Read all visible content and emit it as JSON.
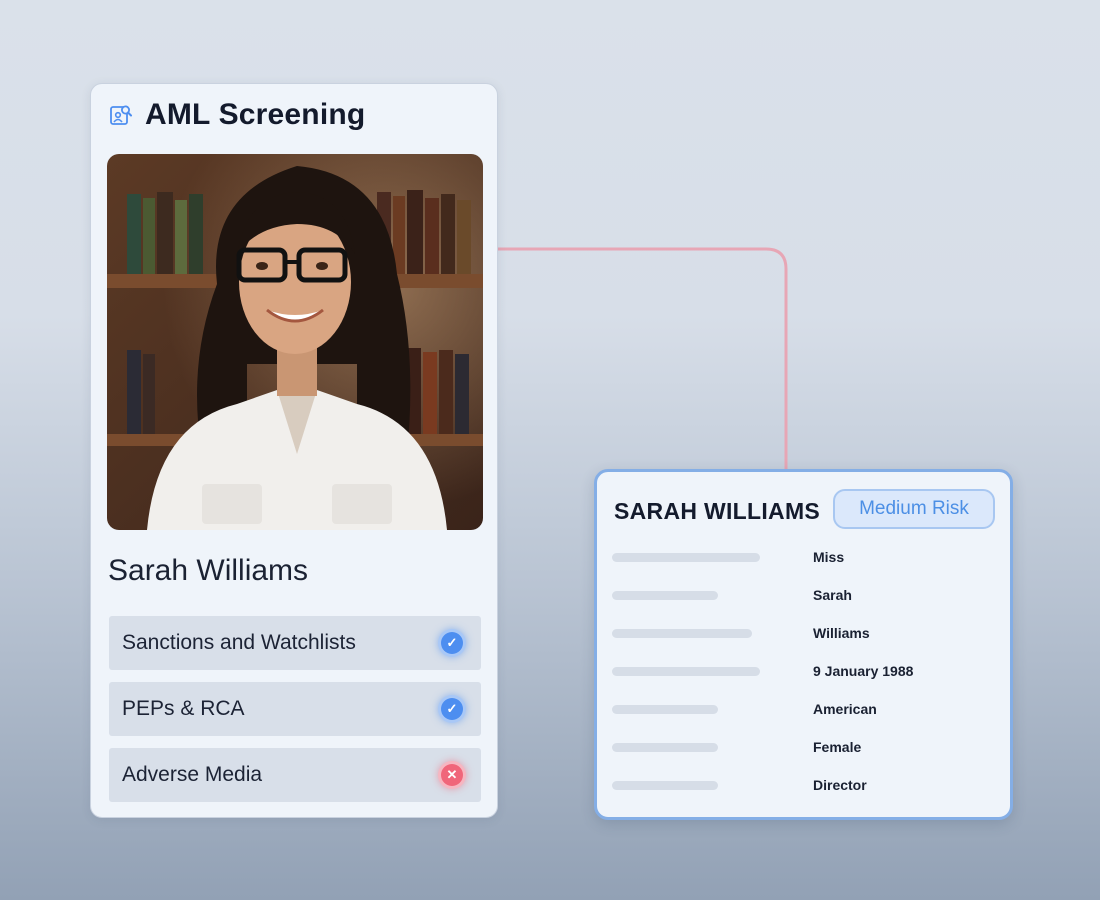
{
  "colors": {
    "accent": "#4d8ef0",
    "connector": "#e7a6b5",
    "pass": "#4d8ef0",
    "fail": "#f0667a",
    "risk_medium": "#4c8fe5"
  },
  "aml_card": {
    "title": "AML Screening",
    "title_icon": "user-search-icon",
    "photo_icon": "profile-photo",
    "person_name": "Sarah Williams",
    "checks": [
      {
        "label": "Sanctions and Watchlists",
        "status": "pass",
        "icon": "check-icon"
      },
      {
        "label": "PEPs & RCA",
        "status": "pass",
        "icon": "check-icon"
      },
      {
        "label": "Adverse Media",
        "status": "fail",
        "icon": "x-icon"
      }
    ]
  },
  "detail_card": {
    "name": "SARAH WILLIAMS",
    "risk_label": "Medium Risk",
    "fields": [
      {
        "value": "Miss"
      },
      {
        "value": "Sarah"
      },
      {
        "value": "Williams"
      },
      {
        "value": "9 January 1988"
      },
      {
        "value": "American"
      },
      {
        "value": "Female"
      },
      {
        "value": "Director"
      }
    ]
  }
}
